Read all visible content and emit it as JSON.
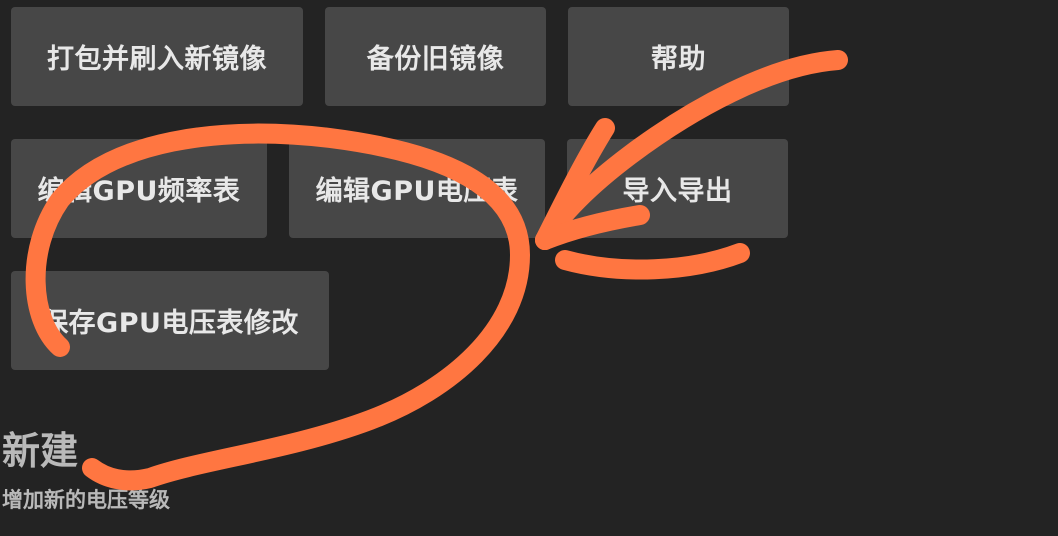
{
  "toolbar": {
    "row1": {
      "flash": "打包并刷入新镜像",
      "backup": "备份旧镜像",
      "help": "帮助"
    },
    "row2": {
      "edit_freq": "编辑GPU频率表",
      "edit_volt": "编辑GPU电压表",
      "import_export": "导入导出"
    },
    "row3": {
      "save_volt": "保存GPU电压表修改"
    }
  },
  "section": {
    "title": "新建",
    "subtitle": "增加新的电压等级"
  },
  "colors": {
    "background": "#232323",
    "button": "#474747",
    "button_text": "#e8e8e8",
    "annotation": "#ff7641"
  }
}
